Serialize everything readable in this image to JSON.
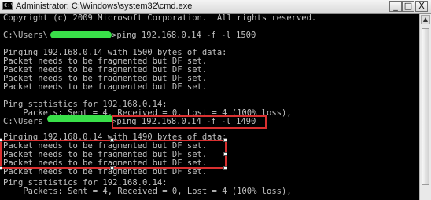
{
  "window": {
    "title": "Administrator: C:\\Windows\\system32\\cmd.exe",
    "icon": "console-icon",
    "controls": {
      "minimize": "_",
      "maximize": "□",
      "close": "X"
    }
  },
  "console": {
    "lines": [
      "Copyright (c) 2009 Microsoft Corporation.  All rights reserved.",
      "C:\\Users\\",
      "Pinging 192.168.0.14 with 1500 bytes of data:",
      "Packet needs to be fragmented but DF set.",
      "Packet needs to be fragmented but DF set.",
      "Packet needs to be fragmented but DF set.",
      "Packet needs to be fragmented but DF set.",
      "Ping statistics for 192.168.0.14:",
      "    Packets: Sent = 4, Received = 0, Lost = 4 (100% loss),",
      "C:\\Users",
      "Pinging 192.168.0.14 with 1490 bytes of data:",
      "Packet needs to be fragmented but DF set.",
      "Packet needs to be fragmented but DF set.",
      "Packet needs to be fragmented but DF set.",
      "Packet needs to be fragmented but DF set.",
      "Ping statistics for 192.168.0.14:",
      "    Packets: Sent = 4, Received = 0, Lost = 4 (100% loss),"
    ],
    "commands": {
      "first": ">ping 192.168.0.14 -f -l 1500",
      "second": ">ping 192.168.0.14 -f -l 1490"
    }
  },
  "colors": {
    "redaction": "#39e049",
    "highlight": "#d93030",
    "console_text": "#c0c0c0",
    "console_bg": "#000000"
  }
}
